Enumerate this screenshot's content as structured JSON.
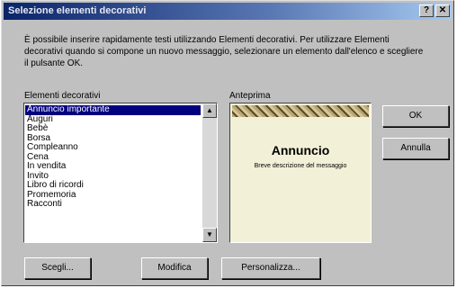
{
  "window": {
    "title": "Selezione elementi decorativi",
    "help_glyph": "?",
    "close_glyph": "✕"
  },
  "intro_text": "È possibile inserire rapidamente testi utilizzando Elementi decorativi. Per utilizzare Elementi decorativi quando si compone un nuovo messaggio, selezionare un elemento dall'elenco e scegliere il pulsante OK.",
  "list": {
    "label": "Elementi decorativi",
    "items": [
      "Annuncio importante",
      "Auguri",
      "Bebè",
      "Borsa",
      "Compleanno",
      "Cena",
      "In vendita",
      "Invito",
      "Libro di ricordi",
      "Promemoria",
      "Racconti"
    ],
    "selected_index": 0
  },
  "preview": {
    "label": "Anteprima",
    "title": "Annuncio",
    "subtitle": "Breve descrizione del messaggio"
  },
  "buttons": {
    "ok": "OK",
    "cancel": "Annulla",
    "b1": "Scegli...",
    "b2": "Modifica",
    "b3": "Personalizza..."
  },
  "colors": {
    "dialog_bg": "#c0c0c0",
    "titlebar_start": "#0a246a",
    "selection": "#000080",
    "preview_bg": "#f3f0d8"
  },
  "icons": {
    "scroll_up": "▲",
    "scroll_down": "▼"
  }
}
